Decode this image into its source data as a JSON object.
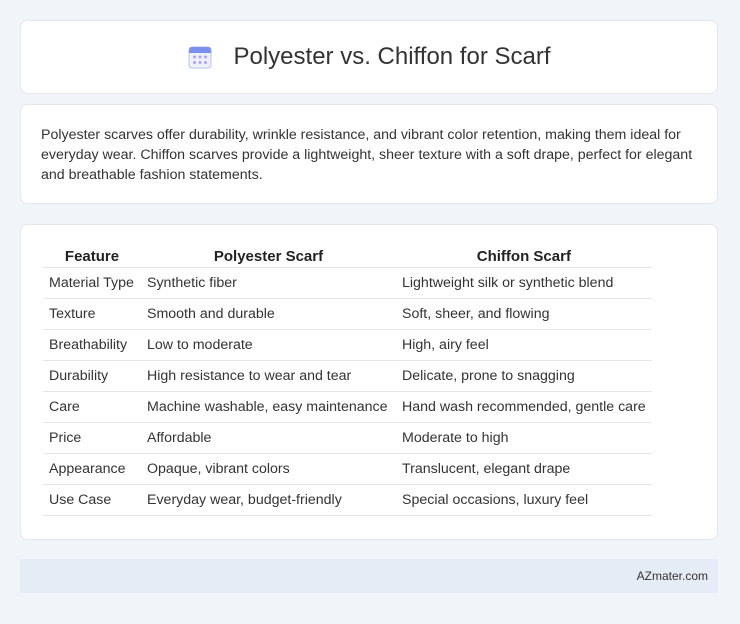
{
  "header": {
    "title": "Polyester vs. Chiffon for Scarf",
    "icon": "calendar-icon"
  },
  "intro": {
    "text": "Polyester scarves offer durability, wrinkle resistance, and vibrant color retention, making them ideal for everyday wear. Chiffon scarves provide a lightweight, sheer texture with a soft drape, perfect for elegant and breathable fashion statements."
  },
  "table": {
    "headers": [
      "Feature",
      "Polyester Scarf",
      "Chiffon Scarf"
    ],
    "rows": [
      [
        "Material Type",
        "Synthetic fiber",
        "Lightweight silk or synthetic blend"
      ],
      [
        "Texture",
        "Smooth and durable",
        "Soft, sheer, and flowing"
      ],
      [
        "Breathability",
        "Low to moderate",
        "High, airy feel"
      ],
      [
        "Durability",
        "High resistance to wear and tear",
        "Delicate, prone to snagging"
      ],
      [
        "Care",
        "Machine washable, easy maintenance",
        "Hand wash recommended, gentle care"
      ],
      [
        "Price",
        "Affordable",
        "Moderate to high"
      ],
      [
        "Appearance",
        "Opaque, vibrant colors",
        "Translucent, elegant drape"
      ],
      [
        "Use Case",
        "Everyday wear, budget-friendly",
        "Special occasions, luxury feel"
      ]
    ]
  },
  "footer": {
    "text": "AZmater.com"
  },
  "colors": {
    "background": "#f1f4f9",
    "footer_bg": "#e6ecf6",
    "icon_accent": "#7b8ff0"
  }
}
